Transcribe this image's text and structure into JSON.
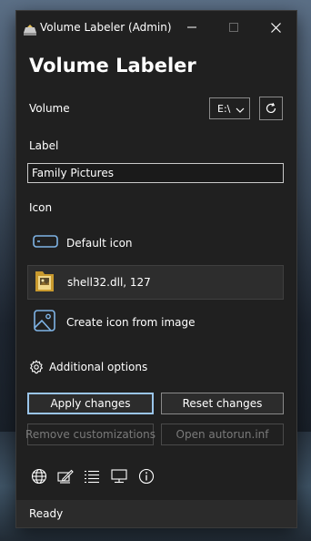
{
  "window": {
    "title": "Volume Labeler (Admin)",
    "heading": "Volume Labeler"
  },
  "volume": {
    "label": "Volume",
    "selected_drive": "E:\\"
  },
  "label_section": {
    "label": "Label",
    "value": "Family Pictures"
  },
  "icon_section": {
    "label": "Icon",
    "options": [
      {
        "label": "Default icon",
        "icon": "drive-icon",
        "selected": false
      },
      {
        "label": "shell32.dll, 127",
        "icon": "folder-pictures-icon",
        "selected": true
      },
      {
        "label": "Create icon from image",
        "icon": "image-icon",
        "selected": false
      }
    ]
  },
  "additional_options": {
    "label": "Additional options",
    "icon": "gear-icon"
  },
  "buttons": {
    "apply": "Apply changes",
    "reset": "Reset changes",
    "remove": "Remove customizations",
    "autorun": "Open autorun.inf"
  },
  "toolbar_icons": [
    "globe-icon",
    "edit-icon",
    "list-icon",
    "monitor-icon",
    "info-icon"
  ],
  "status": "Ready",
  "colors": {
    "window_bg": "#202020",
    "accent": "#7fb4e6",
    "primary_button_border": "#9ac5ea",
    "status_bar_bg": "#2b2b2b"
  }
}
